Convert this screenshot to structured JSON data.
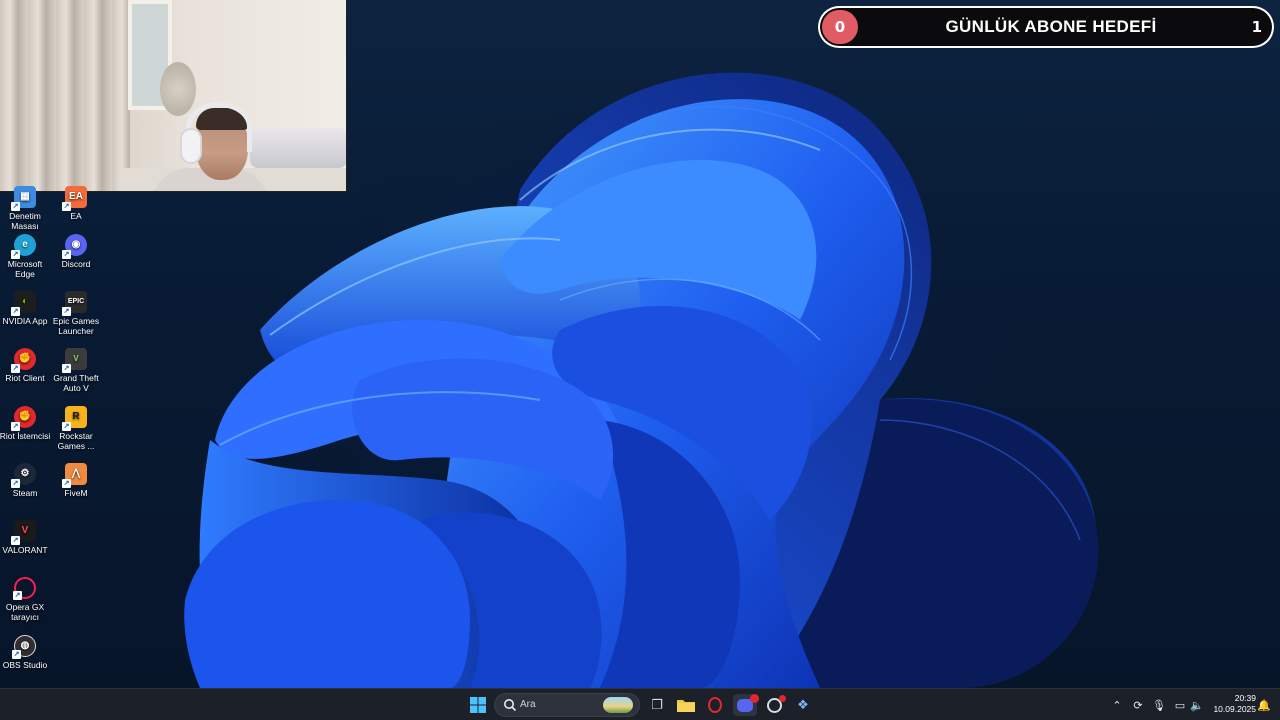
{
  "subscriber_goal": {
    "start_value": "0",
    "title": "GÜNLÜK ABONE HEDEFİ",
    "target_value": "1",
    "progress_fraction": 0,
    "accent_color": "#e05b63"
  },
  "desktop_icons": [
    {
      "label": "Denetim Masası",
      "icon": "control-panel-icon",
      "color": "#3d8be0"
    },
    {
      "label": "EA",
      "icon": "ea-icon",
      "color": "#f26b3a"
    },
    {
      "label": "Microsoft Edge",
      "icon": "edge-icon",
      "color": "#1fa0d6"
    },
    {
      "label": "Discord",
      "icon": "discord-icon",
      "color": "#5865f2"
    },
    {
      "label": "NVIDIA App",
      "icon": "nvidia-icon",
      "color": "#76b900"
    },
    {
      "label": "Epic Games Launcher",
      "icon": "epic-games-icon",
      "color": "#2a2a2a"
    },
    {
      "label": "Riot Client",
      "icon": "riot-client-icon",
      "color": "#e0282e"
    },
    {
      "label": "Grand Theft Auto V",
      "icon": "gta-v-icon",
      "color": "#3b3b3b"
    },
    {
      "label": "Riot İstemcisi",
      "icon": "riot-client-icon",
      "color": "#e0282e"
    },
    {
      "label": "Rockstar Games ...",
      "icon": "rockstar-icon",
      "color": "#f7b31b"
    },
    {
      "label": "Steam",
      "icon": "steam-icon",
      "color": "#1b2838"
    },
    {
      "label": "FiveM",
      "icon": "fivem-icon",
      "color": "#f08a3e"
    },
    {
      "label": "VALORANT",
      "icon": "valorant-icon",
      "color": "#ff4655"
    },
    {
      "label": "Opera GX tarayıcı",
      "icon": "opera-gx-icon",
      "color": "#fa1e4e"
    },
    {
      "label": "OBS Studio",
      "icon": "obs-icon",
      "color": "#302e31"
    }
  ],
  "taskbar": {
    "start_icon": "windows-start-icon",
    "search_placeholder": "Ara",
    "apps": [
      {
        "name": "task-view-icon",
        "glyph": "❐",
        "color": "#d7dbe2"
      },
      {
        "name": "file-explorer-icon",
        "glyph": "▬",
        "color": "#f2c744"
      },
      {
        "name": "opera-gx-icon",
        "glyph": "O",
        "color": "#e0282e"
      },
      {
        "name": "discord-icon",
        "glyph": "◉",
        "color": "#5865f2",
        "badge": "9+"
      },
      {
        "name": "chrome-icon",
        "glyph": "◎",
        "color": "#d7dbe2"
      },
      {
        "name": "app-icon",
        "glyph": "❖",
        "color": "#7fb6ff"
      }
    ],
    "tray_icons": [
      "chevron-up-icon",
      "sync-icon",
      "microphone-icon",
      "display-icon",
      "volume-icon"
    ],
    "time": "20:39",
    "date": "10.09.2025",
    "notification_icon": "notification-icon"
  }
}
